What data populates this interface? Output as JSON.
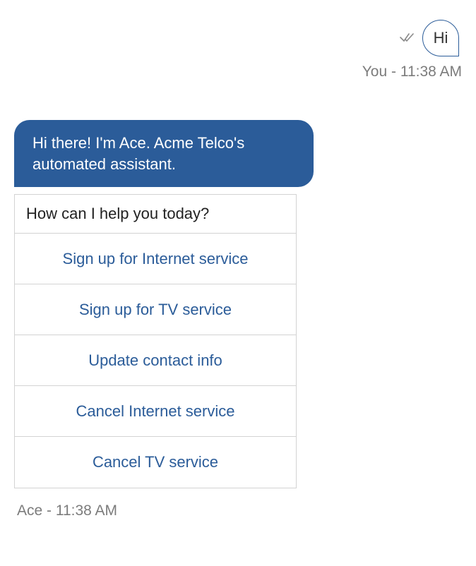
{
  "user": {
    "message": "Hi",
    "meta": "You - 11:38 AM"
  },
  "bot": {
    "greeting": "Hi there! I'm Ace. Acme Telco's automated assistant.",
    "meta": "Ace - 11:38 AM"
  },
  "options": {
    "header": "How can I help you today?",
    "items": [
      "Sign up for Internet service",
      "Sign up for TV service",
      "Update contact info",
      "Cancel Internet service",
      "Cancel TV service"
    ]
  }
}
